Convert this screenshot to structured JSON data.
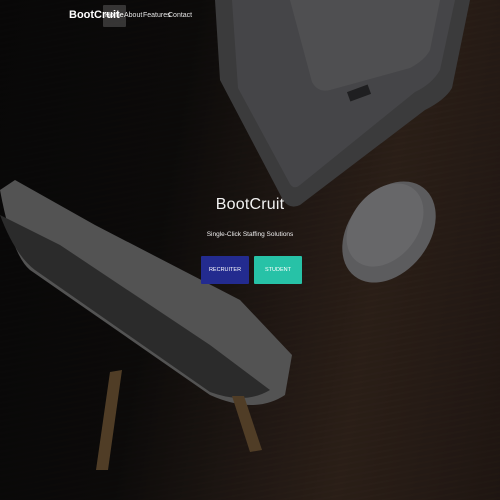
{
  "navbar": {
    "brand": "BootCruit",
    "items": [
      "Home",
      "About",
      "Features",
      "Contact"
    ]
  },
  "hero": {
    "title": "BootCruit",
    "subtitle": "Single-Click Staffing Solutions",
    "buttons": {
      "recruiter": "RECRUITER",
      "student": "STUDENT"
    }
  },
  "colors": {
    "recruiter_button": "#232b8f",
    "student_button": "#27c2a7"
  }
}
